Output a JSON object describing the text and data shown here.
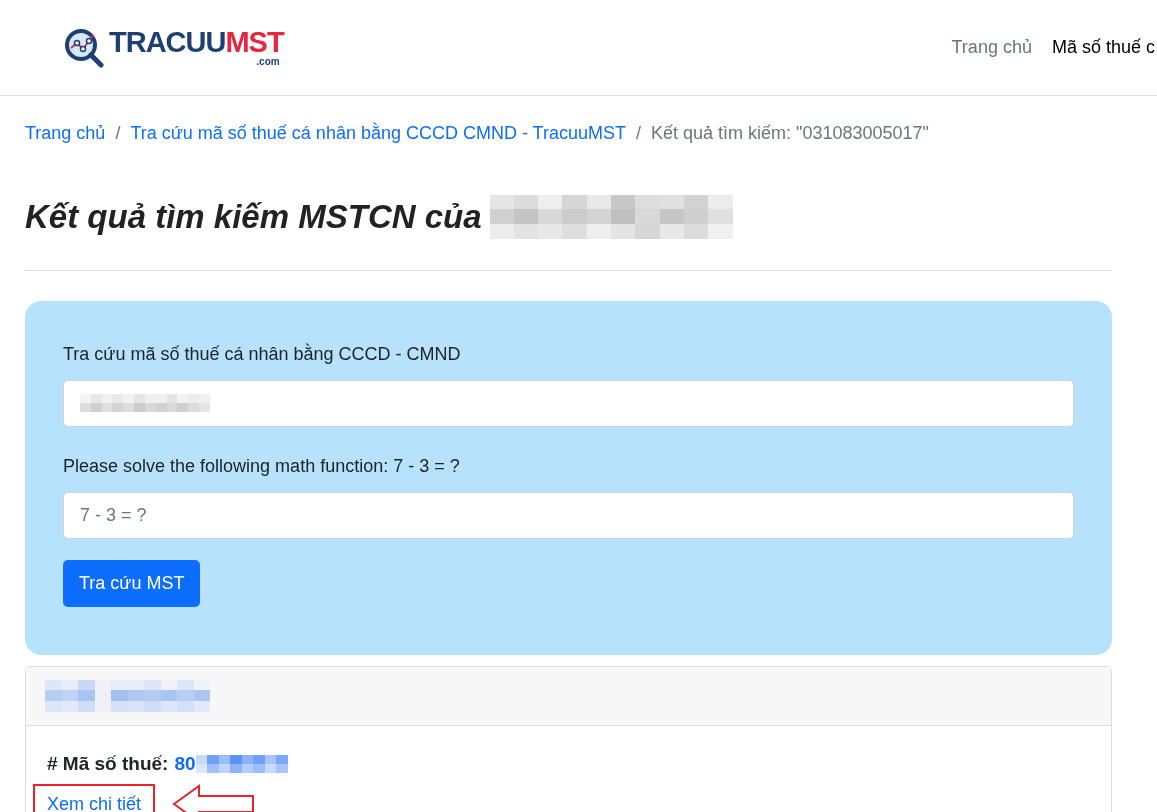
{
  "logo": {
    "part_1": "TRACUU",
    "part_2": "MST",
    "part_3": ".com"
  },
  "nav": [
    {
      "label": "Trang chủ",
      "selected": false
    },
    {
      "label": "Mã số thuế c",
      "selected": true
    }
  ],
  "breadcrumb": [
    {
      "label": "Trang chủ",
      "kind": "link"
    },
    {
      "label": "/",
      "kind": "separator"
    },
    {
      "label": "Tra cứu mã số thuế cá nhân bằng CCCD CMND - TracuuMST",
      "kind": "link"
    },
    {
      "label": "/",
      "kind": "separator"
    },
    {
      "label": "Kết quả tìm kiếm: \"031083005017\"",
      "kind": "current"
    }
  ],
  "heading": "Kết quả tìm kiếm MSTCN của",
  "form": {
    "id_label": "Tra cứu mã số thuế cá nhân bằng CCCD - CMND",
    "math_label": "Please solve the following math function: 7 - 3 = ?",
    "math_placeholder": "7 - 3 = ?",
    "submit": "Tra cứu MST"
  },
  "result": {
    "tax_label": "# Mã số thuế:",
    "tax_value": "80",
    "detail_link": "Xem chi tiết"
  }
}
